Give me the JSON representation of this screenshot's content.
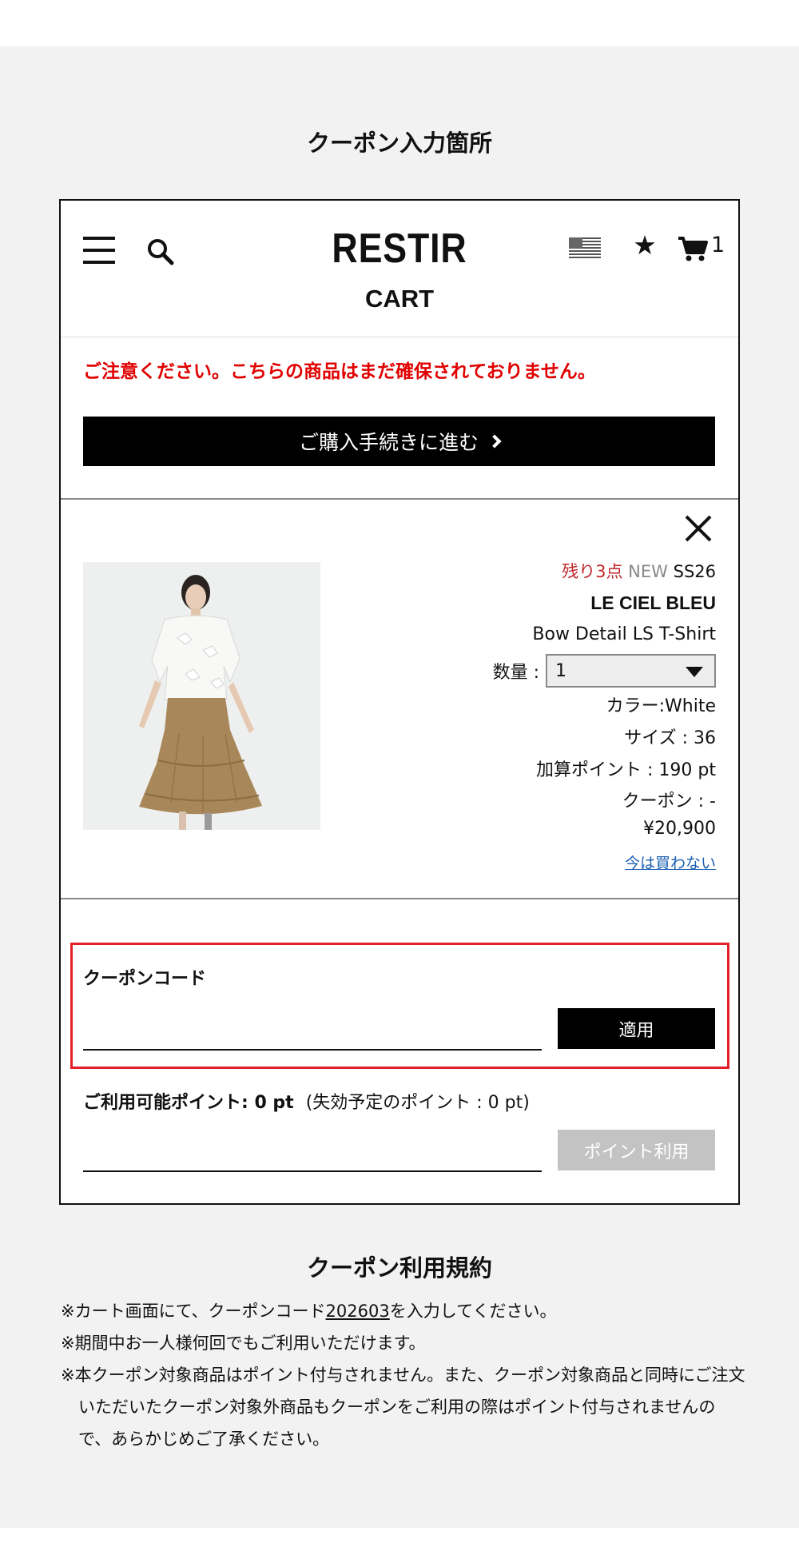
{
  "page": {
    "heading_top": "クーポン入力箇所",
    "heading_bottom": "クーポン利用規約"
  },
  "header": {
    "logo": "RESTIR",
    "title": "CART",
    "cart_count": "1",
    "icons": [
      "menu-icon",
      "search-icon",
      "us-flag-icon",
      "star-icon",
      "cart-icon"
    ]
  },
  "notice": {
    "warning": "ご注意ください。こちらの商品はまだ確保されておりません。",
    "checkout_label": "ご購入手続きに進む"
  },
  "product": {
    "remaining": "残り3点",
    "new_badge": "NEW",
    "season": "SS26",
    "brand": "LE CIEL BLEU",
    "name": "Bow Detail LS T-Shirt",
    "qty_label": "数量 :",
    "qty_value": "1",
    "color": "カラー:White",
    "size": "サイズ :  36",
    "points": "加算ポイント :  190 pt",
    "coupon": "クーポン : -",
    "price": "¥20,900",
    "cancel_link": "今は買わない"
  },
  "coupon": {
    "label": "クーポンコード",
    "input_value": "",
    "apply_label": "適用",
    "points_label": "ご利用可能ポイント: 0 pt",
    "points_note": "(失効予定のポイント : 0 pt)",
    "points_input_value": "",
    "points_button": "ポイント利用"
  },
  "terms": {
    "line1_pre": "※カート画面にて、クーポンコード",
    "line1_code": "202603",
    "line1_post": "を入力してください。",
    "line2": "※期間中お一人様何回でもご利用いただけます。",
    "line3": "※本クーポン対象商品はポイント付与されません。また、クーポン対象商品と同時にご注文いただいたクーポン対象外商品もクーポンをご利用の際はポイント付与されませんので、あらかじめご了承ください。"
  },
  "colors": {
    "warning_red": "#e00000",
    "highlight_red": "#e3202a",
    "link_blue": "#1a5fb4",
    "disabled_gray": "#c3c3c3"
  }
}
